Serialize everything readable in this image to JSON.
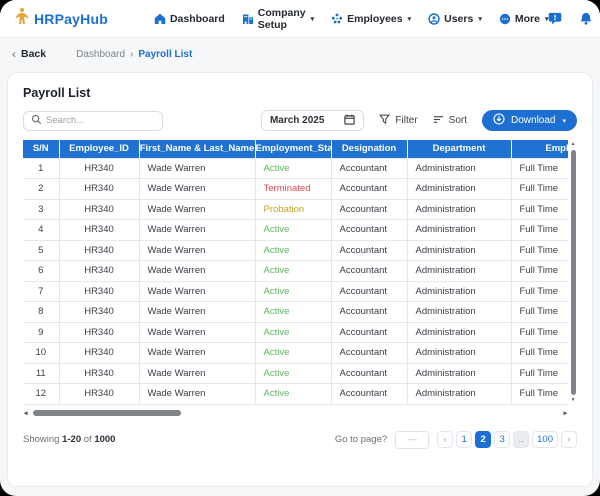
{
  "app": {
    "name": "HRPayHub"
  },
  "nav": {
    "caret": "▾",
    "items": [
      {
        "label": "Dashboard",
        "icon": "home-icon",
        "dropdown": false
      },
      {
        "label": "Company Setup",
        "icon": "building-icon",
        "dropdown": true
      },
      {
        "label": "Employees",
        "icon": "employees-icon",
        "dropdown": true
      },
      {
        "label": "Users",
        "icon": "users-icon",
        "dropdown": true
      },
      {
        "label": "More",
        "icon": "more-icon",
        "dropdown": true
      }
    ]
  },
  "breadcrumb": {
    "back_arrow": "‹",
    "back": "Back",
    "parent": "Dashboard",
    "separator": "›",
    "current": "Payroll List"
  },
  "page": {
    "title": "Payroll List"
  },
  "toolbar": {
    "search_placeholder": "Search...",
    "month": "March 2025",
    "filter": "Filter",
    "sort": "Sort",
    "download": "Download",
    "download_caret": "▾"
  },
  "table": {
    "columns": [
      "S/N",
      "Employee_ID",
      "First_Name & Last_Name",
      "Employment_Status",
      "Designation",
      "Department",
      "Employment_Type"
    ],
    "column_keys": [
      "sn",
      "employee_id",
      "name",
      "status",
      "designation",
      "department",
      "employment_type"
    ],
    "rows": [
      {
        "sn": "1",
        "employee_id": "HR340",
        "name": "Wade Warren",
        "status": "Active",
        "designation": "Accountant",
        "department": "Administration",
        "employment_type": "Full Time"
      },
      {
        "sn": "2",
        "employee_id": "HR340",
        "name": "Wade Warren",
        "status": "Terminated",
        "designation": "Accountant",
        "department": "Administration",
        "employment_type": "Full Time"
      },
      {
        "sn": "3",
        "employee_id": "HR340",
        "name": "Wade Warren",
        "status": "Probation",
        "designation": "Accountant",
        "department": "Administration",
        "employment_type": "Full Time"
      },
      {
        "sn": "4",
        "employee_id": "HR340",
        "name": "Wade Warren",
        "status": "Active",
        "designation": "Accountant",
        "department": "Administration",
        "employment_type": "Full Time"
      },
      {
        "sn": "5",
        "employee_id": "HR340",
        "name": "Wade Warren",
        "status": "Active",
        "designation": "Accountant",
        "department": "Administration",
        "employment_type": "Full Time"
      },
      {
        "sn": "6",
        "employee_id": "HR340",
        "name": "Wade Warren",
        "status": "Active",
        "designation": "Accountant",
        "department": "Administration",
        "employment_type": "Full Time"
      },
      {
        "sn": "7",
        "employee_id": "HR340",
        "name": "Wade Warren",
        "status": "Active",
        "designation": "Accountant",
        "department": "Administration",
        "employment_type": "Full Time"
      },
      {
        "sn": "8",
        "employee_id": "HR340",
        "name": "Wade Warren",
        "status": "Active",
        "designation": "Accountant",
        "department": "Administration",
        "employment_type": "Full Time"
      },
      {
        "sn": "9",
        "employee_id": "HR340",
        "name": "Wade Warren",
        "status": "Active",
        "designation": "Accountant",
        "department": "Administration",
        "employment_type": "Full Time"
      },
      {
        "sn": "10",
        "employee_id": "HR340",
        "name": "Wade Warren",
        "status": "Active",
        "designation": "Accountant",
        "department": "Administration",
        "employment_type": "Full Time"
      },
      {
        "sn": "11",
        "employee_id": "HR340",
        "name": "Wade Warren",
        "status": "Active",
        "designation": "Accountant",
        "department": "Administration",
        "employment_type": "Full Time"
      },
      {
        "sn": "12",
        "employee_id": "HR340",
        "name": "Wade Warren",
        "status": "Active",
        "designation": "Accountant",
        "department": "Administration",
        "employment_type": "Full Time"
      }
    ]
  },
  "colors": {
    "primary": "#1b6fd2",
    "header_bg": "#1f72d2",
    "logo_gold": "#e8a33d",
    "status": {
      "Active": "#5cb85c",
      "Terminated": "#e5484d",
      "Probation": "#c9a227"
    }
  },
  "footer": {
    "showing_prefix": "Showing",
    "range": "1-20",
    "of_word": "of",
    "total": "1000",
    "goto_label": "Go to page?",
    "goto_placeholder": "—",
    "prev": "‹",
    "next": "›",
    "pages": [
      "1",
      "2",
      "3",
      "..",
      "100"
    ],
    "active_page": "2"
  }
}
